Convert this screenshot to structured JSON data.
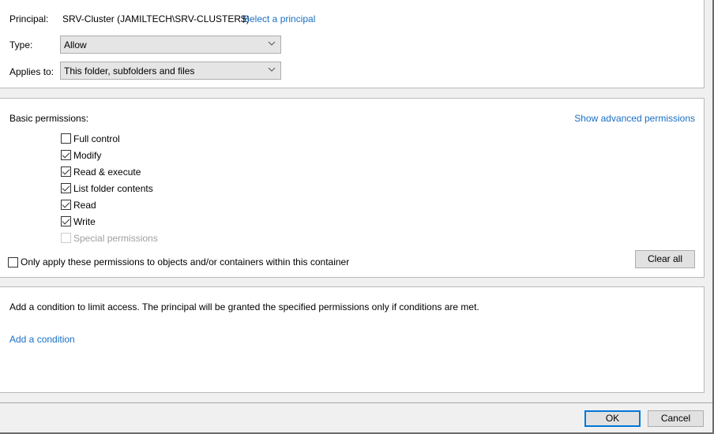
{
  "principal": {
    "label": "Principal:",
    "value": "SRV-Cluster (JAMILTECH\\SRV-CLUSTER$)",
    "select_link": "Select a principal"
  },
  "type": {
    "label": "Type:",
    "selected": "Allow",
    "icon": "chevron-down-icon"
  },
  "applies_to": {
    "label": "Applies to:",
    "selected": "This folder, subfolders and files",
    "icon": "chevron-down-icon"
  },
  "permissions": {
    "label": "Basic permissions:",
    "advanced_link": "Show advanced permissions",
    "items": [
      {
        "label": "Full control",
        "checked": false,
        "disabled": false
      },
      {
        "label": "Modify",
        "checked": true,
        "disabled": false
      },
      {
        "label": "Read & execute",
        "checked": true,
        "disabled": false
      },
      {
        "label": "List folder contents",
        "checked": true,
        "disabled": false
      },
      {
        "label": "Read",
        "checked": true,
        "disabled": false
      },
      {
        "label": "Write",
        "checked": true,
        "disabled": false
      },
      {
        "label": "Special permissions",
        "checked": false,
        "disabled": true
      }
    ],
    "only_apply": {
      "label": "Only apply these permissions to objects and/or containers within this container",
      "checked": false
    },
    "clear_all": "Clear all"
  },
  "condition": {
    "text": "Add a condition to limit access. The principal will be granted the specified permissions only if conditions are met.",
    "add_link": "Add a condition"
  },
  "footer": {
    "ok": "OK",
    "cancel": "Cancel"
  },
  "colors": {
    "link": "#1a6fc4",
    "focus_border": "#0078d7"
  }
}
